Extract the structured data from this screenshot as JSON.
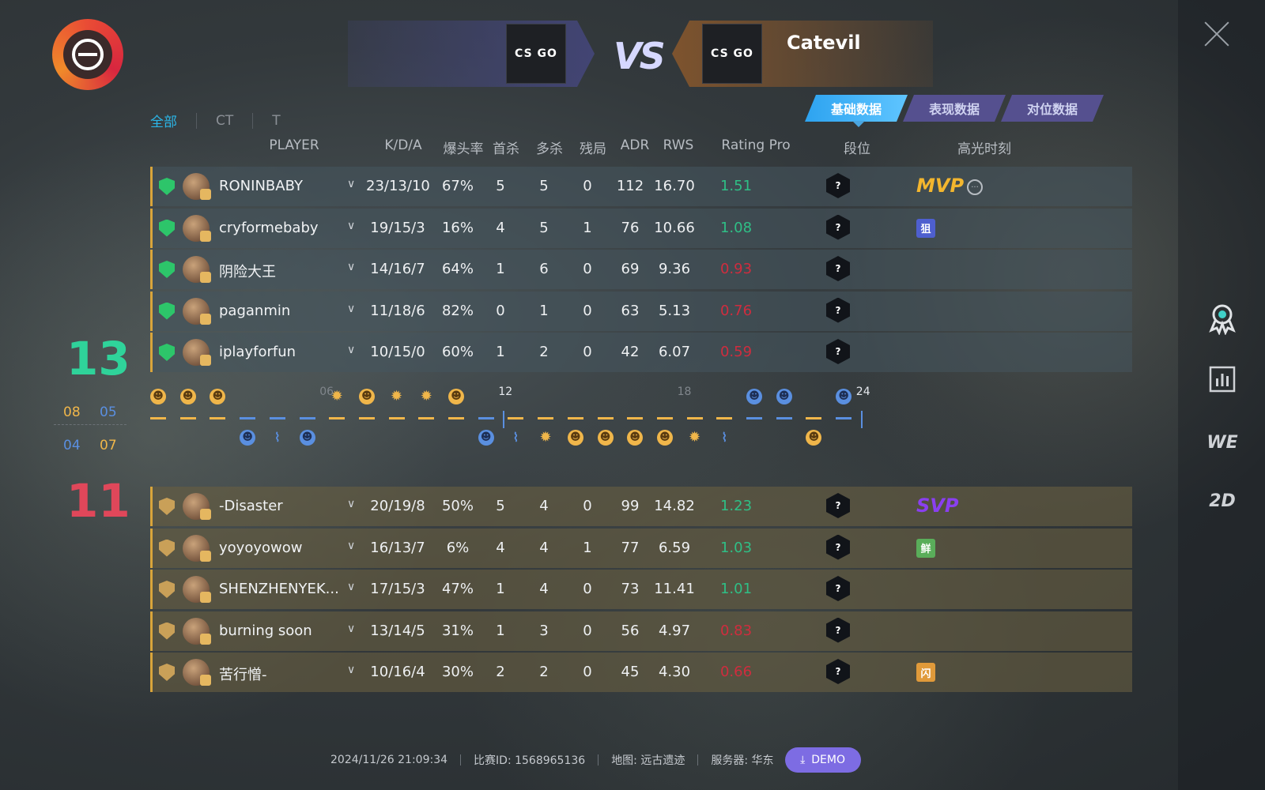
{
  "team_left": {
    "name": "",
    "logo_text": "CS GO"
  },
  "team_right": {
    "name": "Catevil",
    "logo_text": "CS GO"
  },
  "vs": "VS",
  "side_tabs": [
    "全部",
    "CT",
    "T"
  ],
  "data_tabs": [
    "基础数据",
    "表现数据",
    "对位数据"
  ],
  "columns": [
    "PLAYER",
    "K/D/A",
    "爆头率",
    "首杀",
    "多杀",
    "残局",
    "ADR",
    "RWS",
    "Rating Pro",
    "段位",
    "高光时刻"
  ],
  "score": {
    "team1": "13",
    "team2": "11",
    "team1_halves": [
      "08",
      "05"
    ],
    "team2_halves": [
      "04",
      "07"
    ]
  },
  "team1_players": [
    {
      "name": "RONINBABY",
      "kda": "23/13/10",
      "hs": "67%",
      "fk": "5",
      "mk": "5",
      "clutch": "0",
      "adr": "112",
      "rws": "16.70",
      "rating": "1.51",
      "rank": "?",
      "highlight": "MVP"
    },
    {
      "name": "cryformebaby",
      "kda": "19/15/3",
      "hs": "16%",
      "fk": "4",
      "mk": "5",
      "clutch": "1",
      "adr": "76",
      "rws": "10.66",
      "rating": "1.08",
      "rank": "?",
      "highlight": "狙"
    },
    {
      "name": "阴险大王",
      "kda": "14/16/7",
      "hs": "64%",
      "fk": "1",
      "mk": "6",
      "clutch": "0",
      "adr": "69",
      "rws": "9.36",
      "rating": "0.93",
      "rank": "?",
      "highlight": ""
    },
    {
      "name": "paganmin",
      "kda": "11/18/6",
      "hs": "82%",
      "fk": "0",
      "mk": "1",
      "clutch": "0",
      "adr": "63",
      "rws": "5.13",
      "rating": "0.76",
      "rank": "?",
      "highlight": ""
    },
    {
      "name": "iplayforfun",
      "kda": "10/15/0",
      "hs": "60%",
      "fk": "1",
      "mk": "2",
      "clutch": "0",
      "adr": "42",
      "rws": "6.07",
      "rating": "0.59",
      "rank": "?",
      "highlight": ""
    }
  ],
  "team2_players": [
    {
      "name": "-Disaster",
      "kda": "20/19/8",
      "hs": "50%",
      "fk": "5",
      "mk": "4",
      "clutch": "0",
      "adr": "99",
      "rws": "14.82",
      "rating": "1.23",
      "rank": "?",
      "highlight": "SVP"
    },
    {
      "name": "yoyoyowow",
      "kda": "16/13/7",
      "hs": "6%",
      "fk": "4",
      "mk": "4",
      "clutch": "1",
      "adr": "77",
      "rws": "6.59",
      "rating": "1.03",
      "rank": "?",
      "highlight": "鲜"
    },
    {
      "name": "SHENZHENYEK...",
      "kda": "17/15/3",
      "hs": "47%",
      "fk": "1",
      "mk": "4",
      "clutch": "0",
      "adr": "73",
      "rws": "11.41",
      "rating": "1.01",
      "rank": "?",
      "highlight": ""
    },
    {
      "name": "burning soon",
      "kda": "13/14/5",
      "hs": "31%",
      "fk": "1",
      "mk": "3",
      "clutch": "0",
      "adr": "56",
      "rws": "4.97",
      "rating": "0.83",
      "rank": "?",
      "highlight": ""
    },
    {
      "name": "苦行憎-",
      "kda": "10/16/4",
      "hs": "30%",
      "fk": "2",
      "mk": "2",
      "clutch": "0",
      "adr": "45",
      "rws": "4.30",
      "rating": "0.66",
      "rank": "?",
      "highlight": "闪"
    }
  ],
  "timeline": {
    "ticks": [
      "06",
      "12",
      "18",
      "24"
    ],
    "rounds": [
      "t",
      "t",
      "t",
      "ct",
      "ct",
      "ct",
      "t",
      "t",
      "t",
      "t",
      "t",
      "ct",
      "t",
      "t",
      "t",
      "t",
      "t",
      "t",
      "t",
      "t",
      "ct",
      "ct",
      "t",
      "ct"
    ],
    "round_icons": [
      "kill",
      "kill",
      "kill",
      "kill",
      "defuse",
      "kill",
      "bomb",
      "kill",
      "bomb",
      "bomb",
      "kill",
      "kill",
      "defuse",
      "bomb",
      "kill",
      "kill",
      "kill",
      "kill",
      "bomb",
      "defuse",
      "kill",
      "kill",
      "kill",
      "kill"
    ]
  },
  "footer": {
    "datetime": "2024/11/26 21:09:34",
    "match_id": "比赛ID: 1568965136",
    "map": "地图: 远古遗迹",
    "server": "服务器: 华东",
    "demo": "DEMO"
  },
  "side_nav": [
    "award-icon",
    "stats-icon",
    "WE",
    "2D"
  ],
  "colors": {
    "accent": "#2bb6e8",
    "good": "#2fbf86",
    "bad": "#d02c3e",
    "t_side": "#f0b64a",
    "ct_side": "#5a8fe0"
  }
}
